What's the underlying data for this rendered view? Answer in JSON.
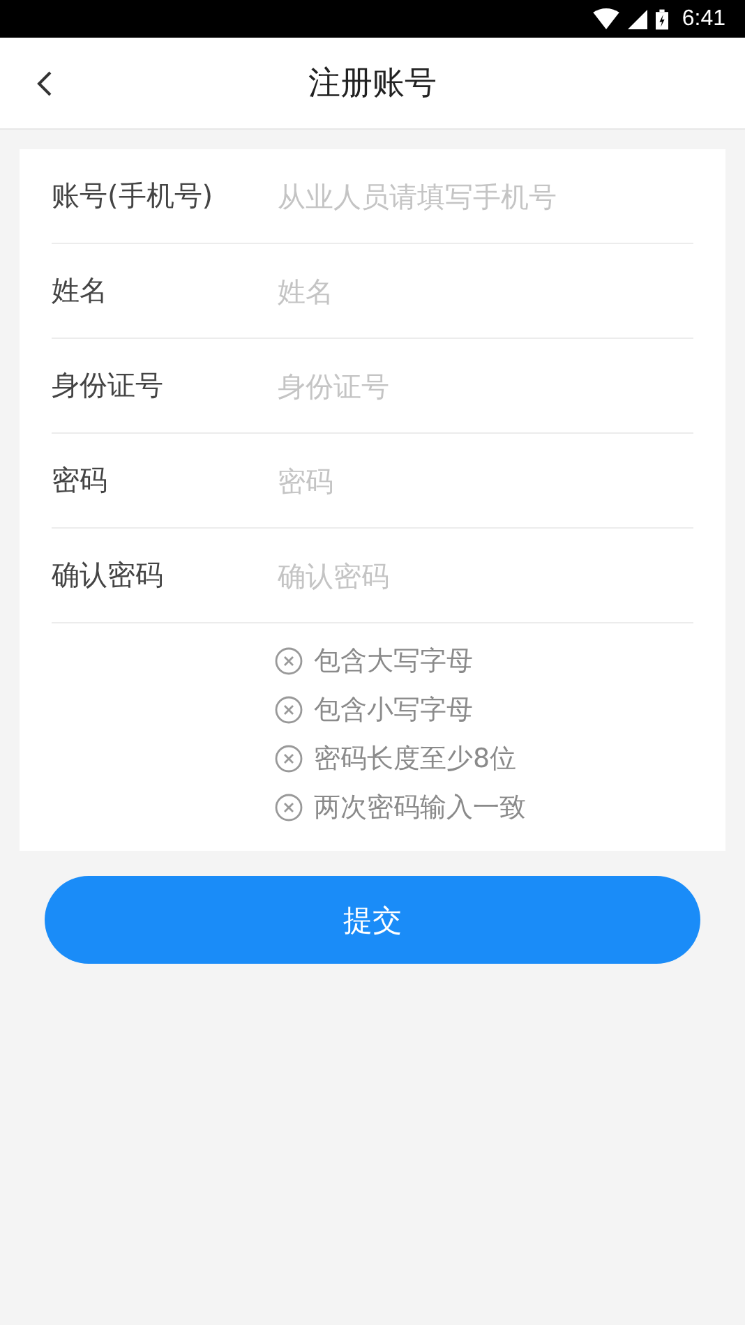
{
  "status_bar": {
    "time": "6:41"
  },
  "header": {
    "title": "注册账号"
  },
  "fields": [
    {
      "label": "账号(手机号)",
      "placeholder": "从业人员请填写手机号"
    },
    {
      "label": "姓名",
      "placeholder": "姓名"
    },
    {
      "label": "身份证号",
      "placeholder": "身份证号"
    },
    {
      "label": "密码",
      "placeholder": "密码"
    },
    {
      "label": "确认密码",
      "placeholder": "确认密码"
    }
  ],
  "password_rules": [
    {
      "text": "包含大写字母",
      "met": false
    },
    {
      "text": "包含小写字母",
      "met": false
    },
    {
      "text": "密码长度至少8位",
      "met": false
    },
    {
      "text": "两次密码输入一致",
      "met": false
    }
  ],
  "submit_button": "提交"
}
